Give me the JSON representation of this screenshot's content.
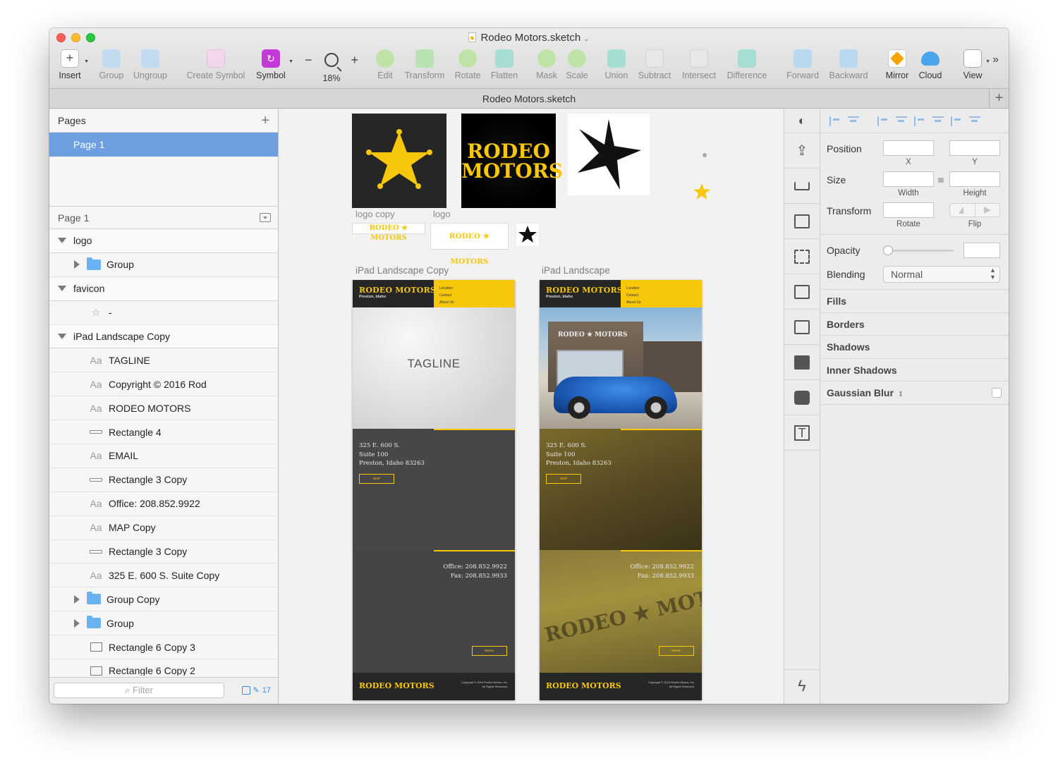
{
  "window": {
    "title": "Rodeo Motors.sketch",
    "tab_title": "Rodeo Motors.sketch"
  },
  "toolbar": {
    "insert": "Insert",
    "group": "Group",
    "ungroup": "Ungroup",
    "create_symbol": "Create Symbol",
    "symbol": "Symbol",
    "zoom_level": "18%",
    "edit": "Edit",
    "transform": "Transform",
    "rotate": "Rotate",
    "flatten": "Flatten",
    "mask": "Mask",
    "scale": "Scale",
    "union": "Union",
    "subtract": "Subtract",
    "intersect": "Intersect",
    "difference": "Difference",
    "forward": "Forward",
    "backward": "Backward",
    "mirror": "Mirror",
    "cloud": "Cloud",
    "view": "View"
  },
  "pages_panel": {
    "header": "Pages",
    "selected_page": "Page 1"
  },
  "layers_panel": {
    "header": "Page 1",
    "items": [
      {
        "label": "logo",
        "kind": "artboard"
      },
      {
        "label": "Group",
        "kind": "group"
      },
      {
        "label": "favicon",
        "kind": "artboard"
      },
      {
        "label": "-",
        "kind": "star"
      },
      {
        "label": "iPad Landscape Copy",
        "kind": "artboard"
      },
      {
        "label": "TAGLINE",
        "kind": "text"
      },
      {
        "label": "Copyright © 2016 Rod",
        "kind": "text"
      },
      {
        "label": "RODEO MOTORS",
        "kind": "text"
      },
      {
        "label": "Rectangle 4",
        "kind": "rect-line"
      },
      {
        "label": "EMAIL",
        "kind": "text"
      },
      {
        "label": "Rectangle 3 Copy",
        "kind": "rect-line"
      },
      {
        "label": "Office: 208.852.9922",
        "kind": "text"
      },
      {
        "label": "MAP Copy",
        "kind": "text"
      },
      {
        "label": "Rectangle 3 Copy",
        "kind": "rect-line"
      },
      {
        "label": "325 E. 600 S. Suite Copy",
        "kind": "text"
      },
      {
        "label": "Group Copy",
        "kind": "group"
      },
      {
        "label": "Group",
        "kind": "group"
      },
      {
        "label": "Rectangle 6 Copy 3",
        "kind": "rect-box"
      },
      {
        "label": "Rectangle 6 Copy 2",
        "kind": "rect-box"
      }
    ],
    "text_icon": "Aa",
    "filter_placeholder": "Filter",
    "count": "17"
  },
  "canvas": {
    "caption_logo_copy": "logo copy",
    "caption_logo": "logo",
    "logo_line1": "RODEO",
    "logo_line2": "MOTORS",
    "small_logo": "RODEO ★ MOTORS",
    "artboard_copy_name": "iPad Landscape Copy",
    "artboard_name": "iPad Landscape",
    "brand": "RODEO MOTORS",
    "location": "Preston, Idaho",
    "nav": [
      "Location",
      "Contact",
      "About Us"
    ],
    "tagline": "TAGLINE",
    "address_lines": [
      "325 E. 600 S.",
      "Suite 100",
      "Preston, Idaho 83263"
    ],
    "map_button": "MAP",
    "office": "Office: 208.852.9922",
    "fax": "Fax: 208.852.9933",
    "email_button": "EMAIL",
    "copyright": "Copyright © 2016 Rodeo Motors, Inc. All Rights Reserved.",
    "building_sign": "RODEO ★ MOTORS",
    "watermark": "RODEO ★ MOTORS"
  },
  "inspector": {
    "position": "Position",
    "x": "X",
    "y": "Y",
    "size": "Size",
    "width": "Width",
    "height": "Height",
    "transform": "Transform",
    "rotate": "Rotate",
    "flip": "Flip",
    "opacity": "Opacity",
    "blending": "Blending",
    "blending_value": "Normal",
    "fills": "Fills",
    "borders": "Borders",
    "shadows": "Shadows",
    "inner_shadows": "Inner Shadows",
    "gaussian_blur": "Gaussian Blur"
  },
  "colors": {
    "accent_yellow": "#f6c70b",
    "selection_blue": "#6d9fe0",
    "symbol_purple": "#c33ad6"
  }
}
